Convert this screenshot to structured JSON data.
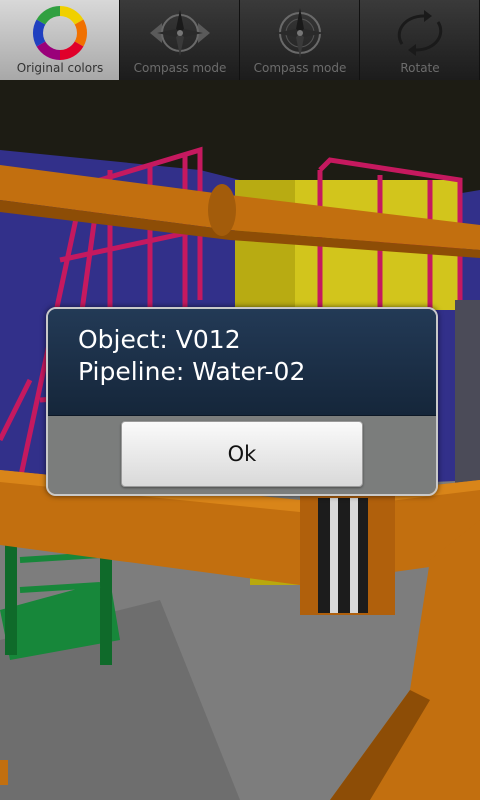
{
  "toolbar": {
    "items": [
      {
        "label": "Original colors",
        "icon": "color-wheel-icon",
        "active": true
      },
      {
        "label": "Compass mode",
        "icon": "compass-icon",
        "active": false
      },
      {
        "label": "Compass mode",
        "icon": "compass-icon",
        "active": false
      },
      {
        "label": "Rotate",
        "icon": "rotate-icon",
        "active": false
      }
    ]
  },
  "dialog": {
    "line1": "Object: V012",
    "line2": "Pipeline: Water-02",
    "ok_label": "Ok"
  },
  "colors": {
    "sky": "#32308a",
    "floor": "#7d7d7d",
    "pipe": "#c26f0f",
    "railing": "#c5195f",
    "equipment_yellow": "#d2c51c",
    "stair_green": "#17873a",
    "dialog_header": "#1c3049",
    "dialog_footer": "#7b7d7c"
  }
}
